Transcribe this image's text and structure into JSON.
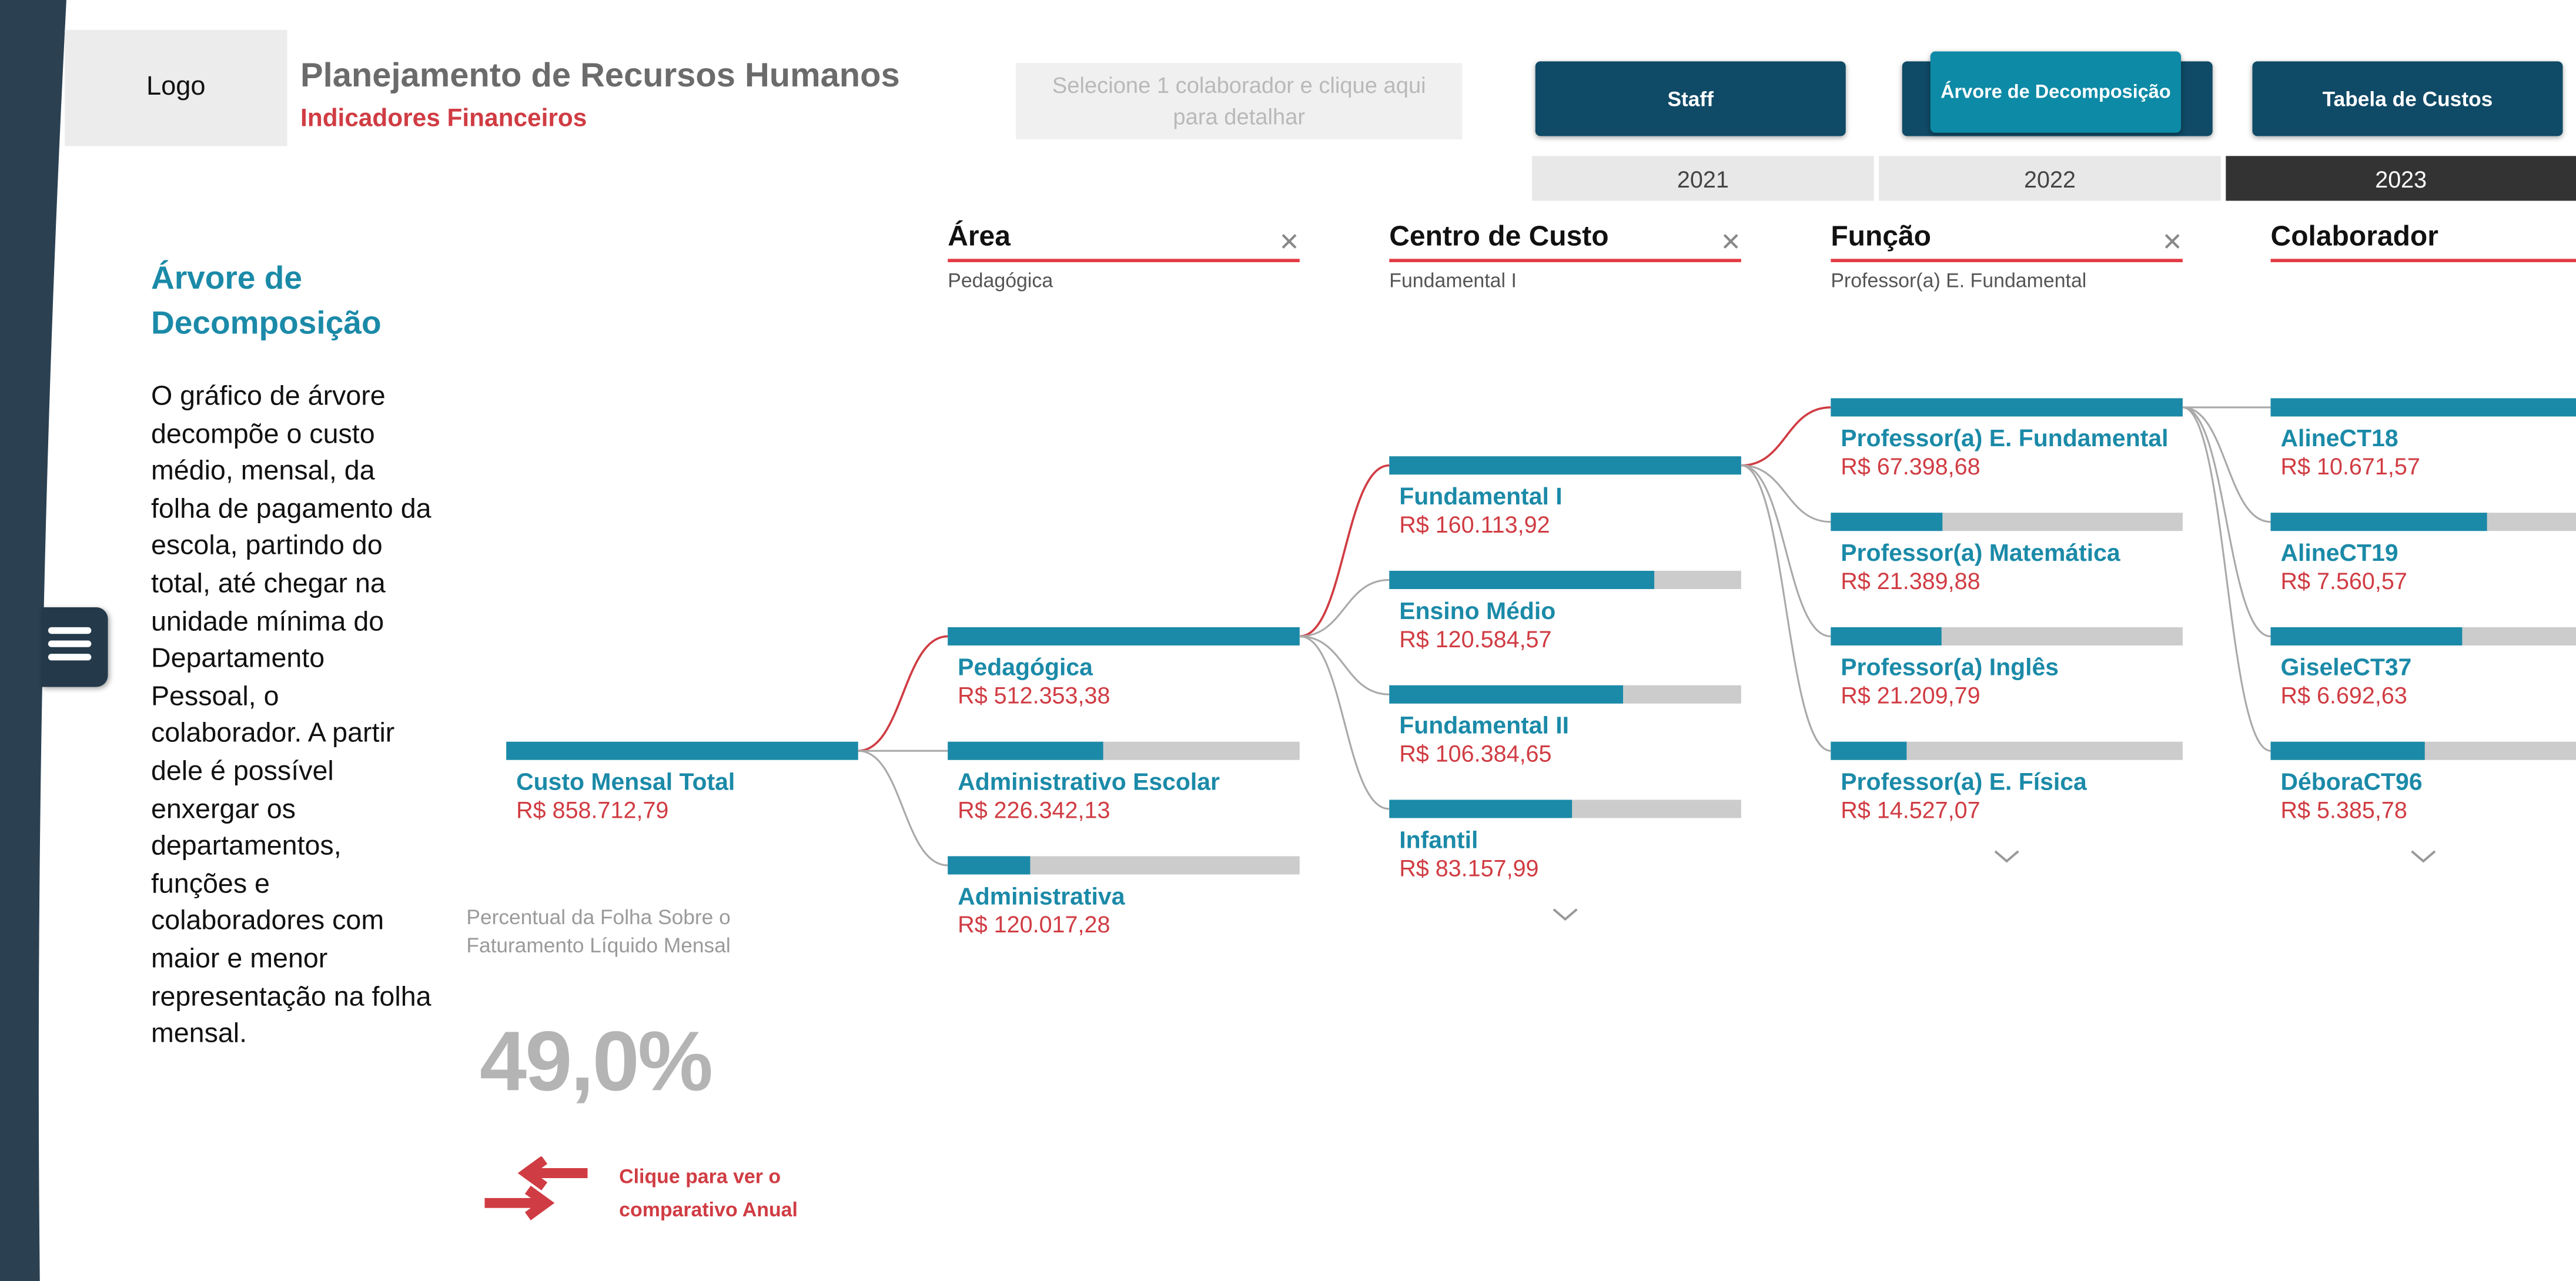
{
  "header": {
    "logo": "Logo",
    "title": "Planejamento de Recursos Humanos",
    "subtitle": "Indicadores Financeiros",
    "detail_button": "Selecione 1 colaborador e clique aqui para detalhar"
  },
  "nav": {
    "staff": "Staff",
    "tree": "Árvore de Decomposição",
    "costs": "Tabela de Custos",
    "active": "tree"
  },
  "years": {
    "items": [
      "2021",
      "2022",
      "2023"
    ],
    "selected": "2023"
  },
  "side_panel": {
    "heading": "Árvore de Decomposição",
    "paragraph": "O gráfico de árvore decompõe o custo médio, mensal, da folha de pagamento da escola, partindo do total, até chegar na unidade mínima do Departamento Pessoal, o colaborador. A partir dele é possível enxergar os departamentos, funções e colaboradores com maior e menor representação na folha mensal."
  },
  "kpi": {
    "label": "Percentual da Folha Sobre o Faturamento Líquido Mensal",
    "value": "49,0%",
    "compare_link": "Clique para ver o comparativo Anual"
  },
  "icons": {
    "menu": "hamburger-menu-icon",
    "close": "close-icon",
    "expand": "chevron-down-icon",
    "compare": "swap-arrows-icon"
  },
  "colors": {
    "sidebar": "#2b4152",
    "nav_button": "#0f4a66",
    "nav_active": "#0d8aa6",
    "accent_teal": "#1b8aa8",
    "accent_red": "#d03c43",
    "bar_fill": "#1b8aa8",
    "bar_track": "#cccccc",
    "year_selected": "#333333"
  },
  "chart_data": {
    "type": "decomposition-tree",
    "columns": [
      {
        "title": "Área",
        "filter": "Pedagógica",
        "closable": true
      },
      {
        "title": "Centro de Custo",
        "filter": "Fundamental I",
        "closable": true
      },
      {
        "title": "Função",
        "filter": "Professor(a) E. Fundamental",
        "closable": true
      },
      {
        "title": "Colaborador",
        "filter": "",
        "closable": false
      }
    ],
    "root": {
      "label": "Custo Mensal Total",
      "value_text": "R$ 858.712,79",
      "value": 858712.79
    },
    "levels": [
      {
        "name": "Área",
        "selected": 0,
        "has_more": false,
        "nodes": [
          {
            "label": "Pedagógica",
            "value_text": "R$ 512.353,38",
            "value": 512353.38
          },
          {
            "label": "Administrativo Escolar",
            "value_text": "R$ 226.342,13",
            "value": 226342.13
          },
          {
            "label": "Administrativa",
            "value_text": "R$ 120.017,28",
            "value": 120017.28
          }
        ]
      },
      {
        "name": "Centro de Custo",
        "selected": 0,
        "has_more": true,
        "nodes": [
          {
            "label": "Fundamental I",
            "value_text": "R$ 160.113,92",
            "value": 160113.92
          },
          {
            "label": "Ensino Médio",
            "value_text": "R$ 120.584,57",
            "value": 120584.57
          },
          {
            "label": "Fundamental II",
            "value_text": "R$ 106.384,65",
            "value": 106384.65
          },
          {
            "label": "Infantil",
            "value_text": "R$ 83.157,99",
            "value": 83157.99
          }
        ]
      },
      {
        "name": "Função",
        "selected": 0,
        "has_more": true,
        "nodes": [
          {
            "label": "Professor(a) E. Fundamental",
            "value_text": "R$ 67.398,68",
            "value": 67398.68
          },
          {
            "label": "Professor(a) Matemática",
            "value_text": "R$ 21.389,88",
            "value": 21389.88
          },
          {
            "label": "Professor(a) Inglês",
            "value_text": "R$ 21.209,79",
            "value": 21209.79
          },
          {
            "label": "Professor(a) E. Física",
            "value_text": "R$ 14.527,07",
            "value": 14527.07
          }
        ]
      },
      {
        "name": "Colaborador",
        "selected": -1,
        "has_more": true,
        "nodes": [
          {
            "label": "AlineCT18",
            "value_text": "R$ 10.671,57",
            "value": 10671.57
          },
          {
            "label": "AlineCT19",
            "value_text": "R$ 7.560,57",
            "value": 7560.57
          },
          {
            "label": "GiseleCT37",
            "value_text": "R$ 6.692,63",
            "value": 6692.63
          },
          {
            "label": "DéboraCT96",
            "value_text": "R$ 5.385,78",
            "value": 5385.78
          }
        ]
      }
    ]
  }
}
